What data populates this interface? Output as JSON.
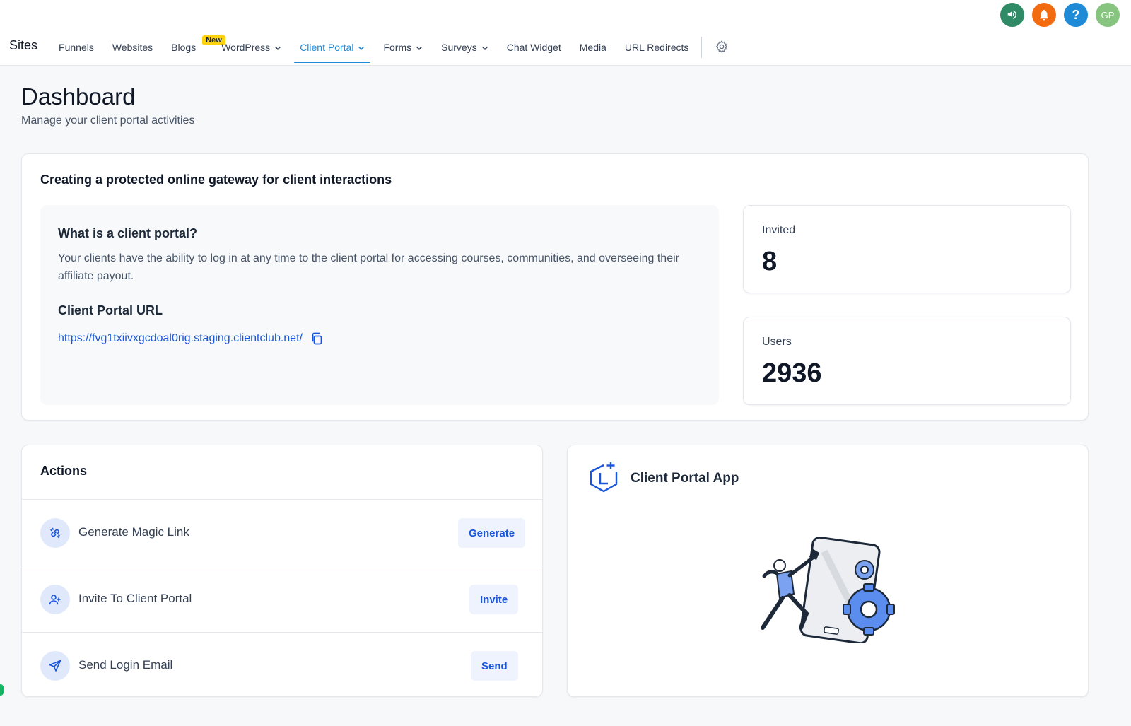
{
  "header": {
    "avatar_initials": "GP",
    "icons": {
      "announce": "megaphone-icon",
      "notify": "bell-icon",
      "help": "help-icon"
    },
    "colors": {
      "announce": "#2f8a66",
      "notify": "#f26b11",
      "help": "#1f8ad6",
      "avatar": "#86c47f"
    }
  },
  "nav": {
    "brand": "Sites",
    "items": {
      "funnels": "Funnels",
      "websites": "Websites",
      "blogs": "Blogs",
      "blogs_badge": "New",
      "wordpress": "WordPress",
      "client_portal": "Client Portal",
      "forms": "Forms",
      "surveys": "Surveys",
      "chat_widget": "Chat Widget",
      "media": "Media",
      "url_redirects": "URL Redirects"
    },
    "active": "Client Portal"
  },
  "page": {
    "title": "Dashboard",
    "subtitle": "Manage your client portal activities"
  },
  "main_card": {
    "title": "Creating a protected online gateway for client interactions",
    "info_heading": "What is a client portal?",
    "info_text": "Your clients have the ability to log in at any time to the client portal for accessing courses, communities, and overseeing their affiliate payout.",
    "url_heading": "Client Portal URL",
    "url": "https://fvg1txiivxgcdoal0rig.staging.clientclub.net/"
  },
  "stats": {
    "invited_label": "Invited",
    "invited_value": "8",
    "users_label": "Users",
    "users_value": "2936"
  },
  "actions": {
    "title": "Actions",
    "rows": [
      {
        "label": "Generate Magic Link",
        "button": "Generate"
      },
      {
        "label": "Invite To Client Portal",
        "button": "Invite"
      },
      {
        "label": "Send Login Email",
        "button": "Send"
      }
    ]
  },
  "app_card": {
    "title": "Client Portal App"
  },
  "theme": {
    "accent": "#1f8ad6",
    "link": "#1a56db"
  }
}
